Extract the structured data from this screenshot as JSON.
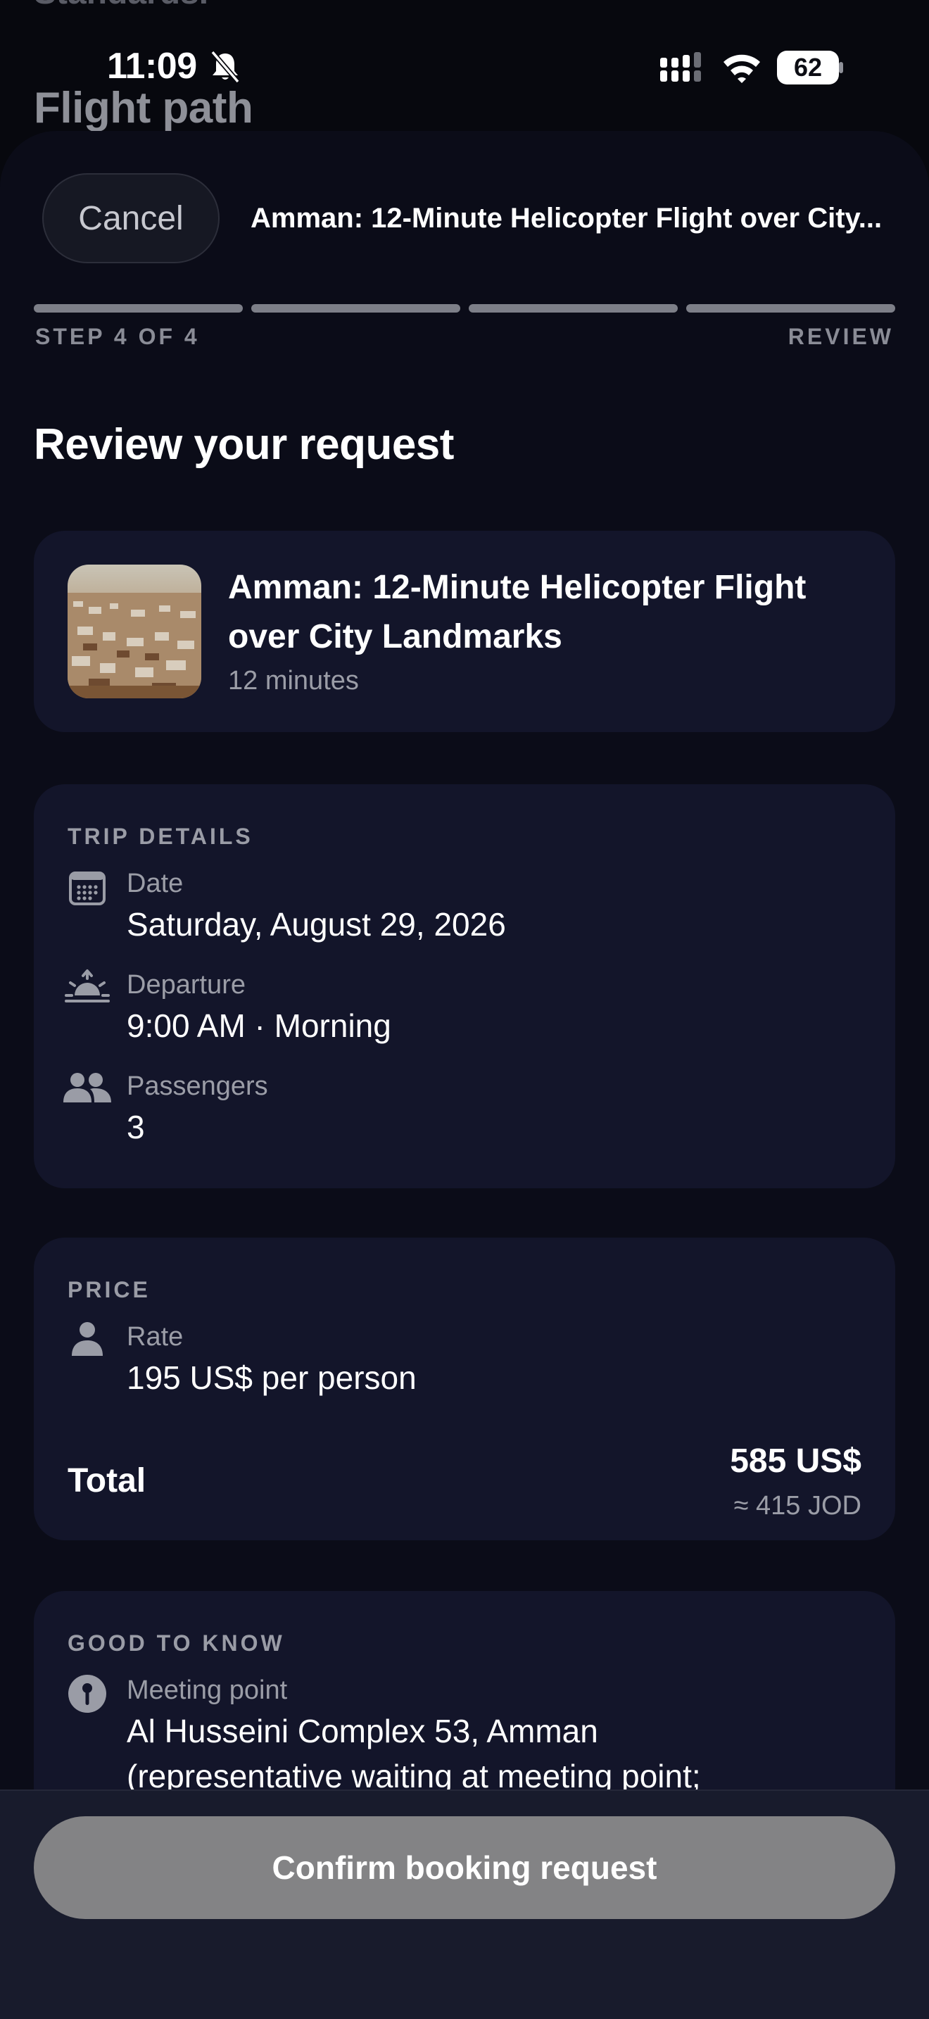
{
  "background": {
    "peek_text": "Standards.",
    "title": "Flight path"
  },
  "status_bar": {
    "time": "11:09",
    "battery": "62",
    "icons": [
      "bell-slash-icon",
      "cellular-signal-icon",
      "wifi-icon",
      "battery-icon"
    ]
  },
  "header": {
    "cancel_label": "Cancel",
    "title": "Amman: 12-Minute Helicopter Flight over City..."
  },
  "progress": {
    "current_step": 4,
    "total_steps": 4,
    "step_text": "STEP 4 OF 4",
    "step_name": "REVIEW"
  },
  "page": {
    "heading": "Review your request"
  },
  "experience": {
    "title": "Amman: 12-Minute Helicopter Flight over City Landmarks",
    "duration": "12 minutes"
  },
  "trip_details": {
    "section_label": "TRIP DETAILS",
    "items": [
      {
        "icon": "calendar-icon",
        "label": "Date",
        "value": "Saturday, August 29, 2026"
      },
      {
        "icon": "sunrise-icon",
        "label": "Departure",
        "value": "9:00 AM · Morning"
      },
      {
        "icon": "people-icon",
        "label": "Passengers",
        "value": "3"
      }
    ]
  },
  "price": {
    "section_label": "PRICE",
    "rate_icon": "person-icon",
    "rate_label": "Rate",
    "rate_value": "195 US$ per person",
    "total_label": "Total",
    "total_value": "585 US$",
    "total_converted": "≈ 415 JOD"
  },
  "good_to_know": {
    "section_label": "GOOD TO KNOW",
    "meeting_icon": "map-pin-icon",
    "meeting_label": "Meeting point",
    "meeting_value_line1": "Al Husseini Complex 53, Amman",
    "meeting_value_line2": "(representative waiting at meeting point;"
  },
  "actions": {
    "confirm_label": "Confirm booking request"
  },
  "colors": {
    "background": "#07080e",
    "sheet": "#0b0c18",
    "card": "#13152a",
    "muted_text": "#9b9da7",
    "button_disabled": "#838385"
  }
}
